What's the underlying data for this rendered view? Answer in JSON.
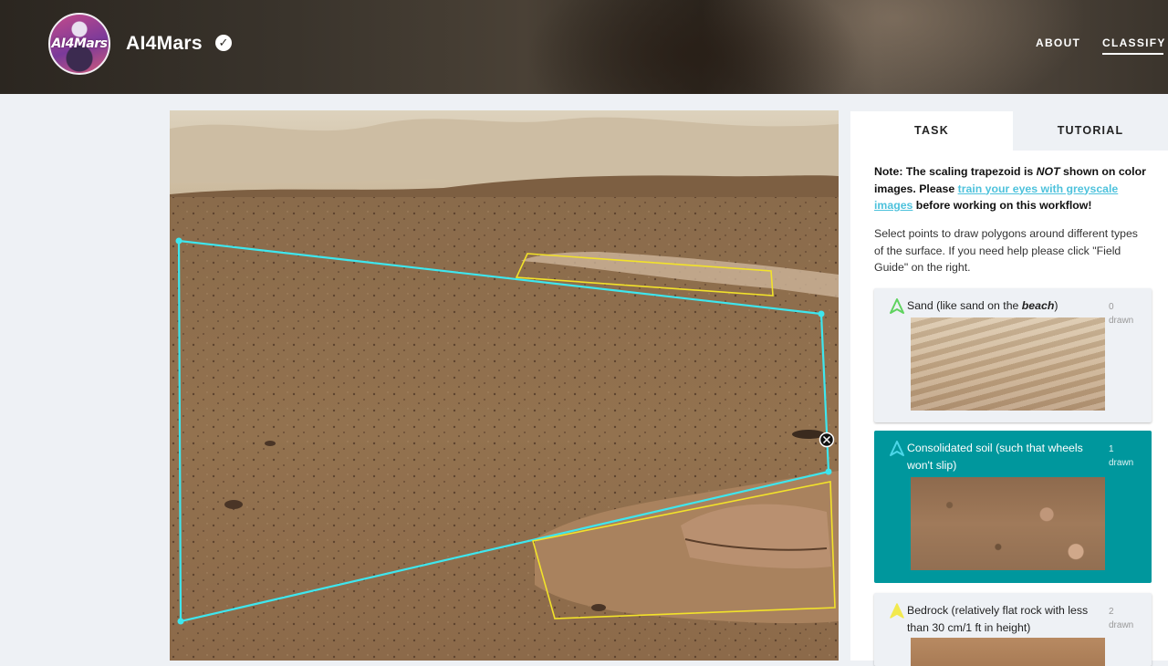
{
  "header": {
    "logo_text": "AI4Mars",
    "project_name": "AI4Mars",
    "verified_icon": "check-circle-icon",
    "nav": [
      {
        "label": "ABOUT",
        "active": false
      },
      {
        "label": "CLASSIFY",
        "active": true
      }
    ]
  },
  "tabs": {
    "task": "TASK",
    "tutorial": "TUTORIAL"
  },
  "note": {
    "prefix": "Note: The scaling trapezoid is ",
    "emphasis": "NOT",
    "middle": " shown on color images. Please ",
    "link": "train your eyes with greyscale images",
    "suffix": " before working on this workflow!"
  },
  "instructions": "Select points to draw polygons around different types of the surface. If you need help please click \"Field Guide\" on the right.",
  "options": {
    "sand": {
      "label_prefix": "Sand (like sand on the ",
      "label_em": "beach",
      "label_suffix": ")",
      "count": "0",
      "count_unit": "drawn",
      "color": "#5fd35f"
    },
    "soil": {
      "label": "Consolidated soil (such that wheels won't slip)",
      "count": "1",
      "count_unit": "drawn",
      "color": "#4bd6e8"
    },
    "bedrock": {
      "label": "Bedrock (relatively flat rock with less than 30 cm/1 ft in height)",
      "count": "2",
      "count_unit": "drawn",
      "color": "#f2e94e"
    }
  },
  "annotation_colors": {
    "soil_polygon": "#3ee6ee",
    "bedrock_polygon": "#f2e22a",
    "selected_option_bg": "#00979d"
  }
}
